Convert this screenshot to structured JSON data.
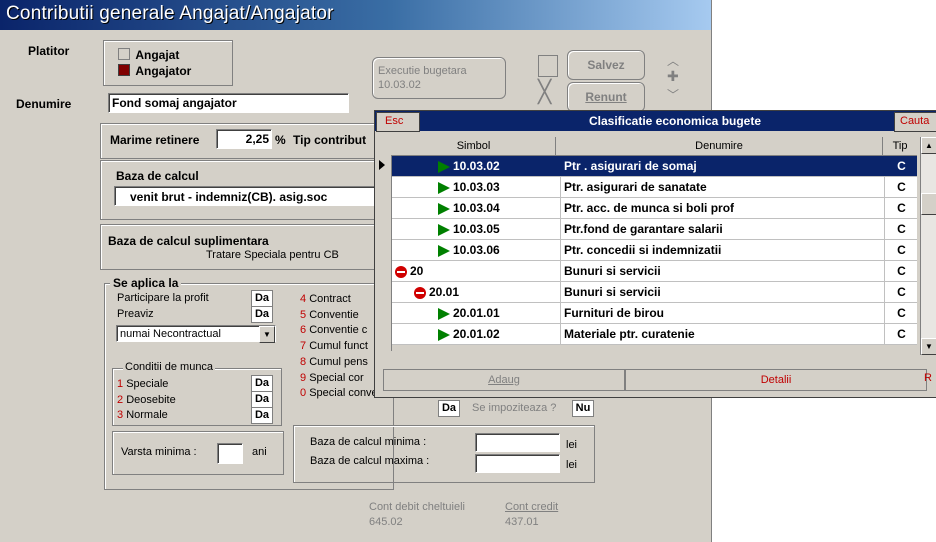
{
  "window": {
    "title": "Contributii generale Angajat/Angajator"
  },
  "platitor": {
    "label": "Platitor",
    "option1": "Angajat",
    "option2": "Angajator"
  },
  "denumire": {
    "label": "Denumire",
    "value": "Fond somaj angajator"
  },
  "executie": {
    "label": "Executie bugetara",
    "value": "10.03.02"
  },
  "buttons": {
    "save": "Salvez",
    "cancel": "Renunt"
  },
  "marime": {
    "label": "Marime retinere",
    "value": "2,25",
    "unit": "%",
    "tip_label": "Tip contribut"
  },
  "baza": {
    "label": "Baza de calcul",
    "value": "venit brut - indemniz(CB). asig.soc"
  },
  "baza_supl": {
    "label": "Baza de calcul suplimentara",
    "sub": "Tratare Speciala pentru CB"
  },
  "aplica": {
    "label": "Se aplica la",
    "participare": "Participare la profit",
    "participare_val": "Da",
    "preaviz": "Preaviz",
    "preaviz_val": "Da",
    "select_value": "numai Necontractual",
    "items": [
      {
        "num": "4",
        "text": "Contract"
      },
      {
        "num": "5",
        "text": "Conventie"
      },
      {
        "num": "6",
        "text": "Conventie c"
      },
      {
        "num": "7",
        "text": "Cumul funct"
      },
      {
        "num": "8",
        "text": "Cumul pens"
      },
      {
        "num": "9",
        "text": "Special cor"
      },
      {
        "num": "0",
        "text": "Special conventie"
      }
    ],
    "special_val": "Da",
    "impoziteaza": "Se impoziteaza ?",
    "impoziteaza_val": "Nu"
  },
  "conditii": {
    "label": "Conditii de munca",
    "items": [
      {
        "num": "1",
        "text": "Speciale",
        "val": "Da"
      },
      {
        "num": "2",
        "text": "Deosebite",
        "val": "Da"
      },
      {
        "num": "3",
        "text": "Normale",
        "val": "Da"
      }
    ]
  },
  "varsta": {
    "label": "Varsta minima :",
    "unit": "ani"
  },
  "baza_min": {
    "label": "Baza de calcul minima :",
    "unit": "lei"
  },
  "baza_max": {
    "label": "Baza de calcul maxima :",
    "unit": "lei"
  },
  "conturi": {
    "debit_label": "Cont debit cheltuieli",
    "debit_val": "645.02",
    "credit_label": "Cont credit",
    "credit_val": "437.01"
  },
  "lookup": {
    "esc": "Esc",
    "title": "Clasificatie economica bugete",
    "cauta": "Cauta",
    "columns": [
      "Simbol",
      "Denumire",
      "Tip"
    ],
    "rows": [
      {
        "simbol": "10.03.02",
        "denumire": "Ptr . asigurari de somaj",
        "tip": "C",
        "icon": "green-triangle-icon",
        "indent": 2
      },
      {
        "simbol": "10.03.03",
        "denumire": "Ptr. asigurari de sanatate",
        "tip": "C",
        "icon": "green-triangle-icon",
        "indent": 2
      },
      {
        "simbol": "10.03.04",
        "denumire": "Ptr. acc. de munca si boli prof",
        "tip": "C",
        "icon": "green-triangle-icon",
        "indent": 2
      },
      {
        "simbol": "10.03.05",
        "denumire": "Ptr.fond de garantare salarii",
        "tip": "C",
        "icon": "green-triangle-icon",
        "indent": 2
      },
      {
        "simbol": "10.03.06",
        "denumire": "Ptr. concedii si indemnizatii",
        "tip": "C",
        "icon": "green-triangle-icon",
        "indent": 2
      },
      {
        "simbol": "20",
        "denumire": "Bunuri si servicii",
        "tip": "C",
        "icon": "red-minus-icon",
        "indent": 0
      },
      {
        "simbol": "20.01",
        "denumire": "Bunuri si servicii",
        "tip": "C",
        "icon": "red-minus-icon",
        "indent": 1
      },
      {
        "simbol": "20.01.01",
        "denumire": "Furnituri de birou",
        "tip": "C",
        "icon": "green-triangle-icon",
        "indent": 2
      },
      {
        "simbol": "20.01.02",
        "denumire": "Materiale ptr. curatenie",
        "tip": "C",
        "icon": "green-triangle-icon",
        "indent": 2
      }
    ],
    "footer": {
      "adaug": "Adaug",
      "detalii": "Detalii",
      "r": "R"
    }
  },
  "colors": {
    "title_bar": "#0a246a",
    "accent_red": "#c00000",
    "selection": "#0a246a",
    "tree_green": "#008000"
  }
}
